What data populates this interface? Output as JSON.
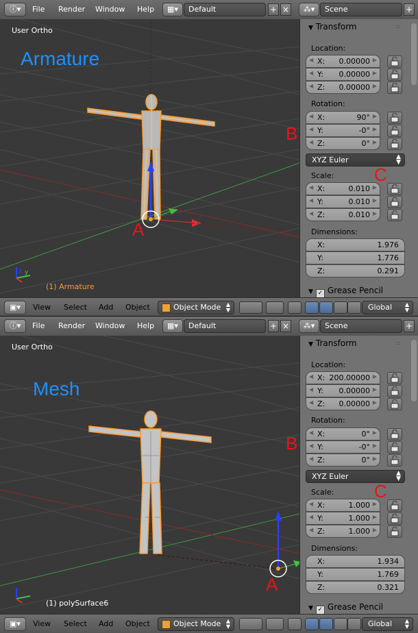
{
  "panes": [
    {
      "menu": [
        "File",
        "Render",
        "Window",
        "Help"
      ],
      "layout": "Default",
      "scene": "Scene",
      "viewport_title": "User Ortho",
      "big_label": "Armature",
      "object_label": "(1) Armature",
      "object_label_color": "#ff9a2e",
      "annotations": {
        "a": "A",
        "b": "B",
        "c": "C"
      },
      "transform": {
        "header": "Transform",
        "location_label": "Location:",
        "location": [
          {
            "axis": "X:",
            "value": "0.00000"
          },
          {
            "axis": "Y:",
            "value": "0.00000"
          },
          {
            "axis": "Z:",
            "value": "0.00000"
          }
        ],
        "rotation_label": "Rotation:",
        "rotation": [
          {
            "axis": "X:",
            "value": "90°"
          },
          {
            "axis": "Y:",
            "value": "-0°"
          },
          {
            "axis": "Z:",
            "value": "0°"
          }
        ],
        "rotation_mode": "XYZ Euler",
        "scale_label": "Scale:",
        "scale": [
          {
            "axis": "X:",
            "value": "0.010"
          },
          {
            "axis": "Y:",
            "value": "0.010"
          },
          {
            "axis": "Z:",
            "value": "0.010"
          }
        ],
        "dimensions_label": "Dimensions:",
        "dimensions": [
          {
            "axis": "X:",
            "value": "1.976"
          },
          {
            "axis": "Y:",
            "value": "1.776"
          },
          {
            "axis": "Z:",
            "value": "0.291"
          }
        ]
      },
      "grease_pencil": "Grease Pencil",
      "bottom": {
        "view": "View",
        "select": "Select",
        "add": "Add",
        "object": "Object",
        "mode": "Object Mode",
        "orientation": "Global"
      }
    },
    {
      "menu": [
        "File",
        "Render",
        "Window",
        "Help"
      ],
      "layout": "Default",
      "scene": "Scene",
      "viewport_title": "User Ortho",
      "big_label": "Mesh",
      "object_label": "(1) polySurface6",
      "object_label_color": "#ffffff",
      "annotations": {
        "a": "A",
        "b": "B",
        "c": "C"
      },
      "transform": {
        "header": "Transform",
        "location_label": "Location:",
        "location": [
          {
            "axis": "X:",
            "value": "200.00000"
          },
          {
            "axis": "Y:",
            "value": "0.00000"
          },
          {
            "axis": "Z:",
            "value": "0.00000"
          }
        ],
        "rotation_label": "Rotation:",
        "rotation": [
          {
            "axis": "X:",
            "value": "0°"
          },
          {
            "axis": "Y:",
            "value": "-0°"
          },
          {
            "axis": "Z:",
            "value": "0°"
          }
        ],
        "rotation_mode": "XYZ Euler",
        "scale_label": "Scale:",
        "scale": [
          {
            "axis": "X:",
            "value": "1.000"
          },
          {
            "axis": "Y:",
            "value": "1.000"
          },
          {
            "axis": "Z:",
            "value": "1.000"
          }
        ],
        "dimensions_label": "Dimensions:",
        "dimensions": [
          {
            "axis": "X:",
            "value": "1.934"
          },
          {
            "axis": "Y:",
            "value": "1.769"
          },
          {
            "axis": "Z:",
            "value": "0.321"
          }
        ]
      },
      "grease_pencil": "Grease Pencil",
      "bottom": {
        "view": "View",
        "select": "Select",
        "add": "Add",
        "object": "Object",
        "mode": "Object Mode",
        "orientation": "Global"
      }
    }
  ],
  "colors": {
    "annotation": "#e8141b",
    "big_label": "#1e90ff",
    "selection": "#ff9a2e",
    "x_axis": "#e03030",
    "y_axis": "#40c040",
    "z_axis": "#2040ff"
  }
}
